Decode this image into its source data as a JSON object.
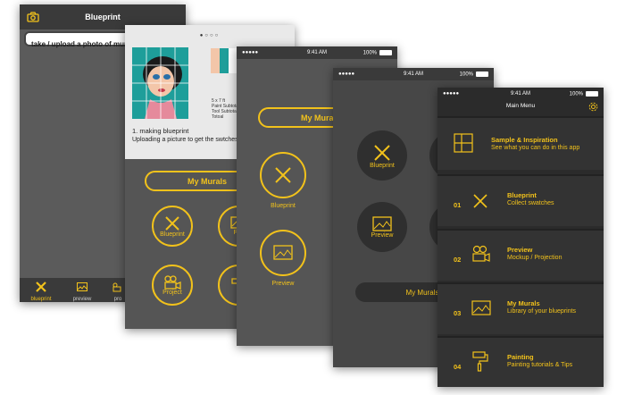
{
  "screen1": {
    "title": "Blueprint",
    "prompt": "take / upload a photo of mural",
    "tabs": [
      {
        "label": "blueprint",
        "icon": "pencil-cross-icon"
      },
      {
        "label": "preview",
        "icon": "picture-icon"
      },
      {
        "label": "pro",
        "icon": "projector-icon"
      }
    ]
  },
  "screen2": {
    "dots": 4,
    "active_dot": 0,
    "step_title": "1. making blueprint",
    "step_desc": "Uploading a picture to get the swtches & price eastimate",
    "details": [
      "5 x 7 ft",
      "Paint Subtotal",
      "Tool Subtotal",
      "Totoal"
    ],
    "my_murals": "My Murals",
    "circles": [
      {
        "label": "Blueprint",
        "icon": "pencil-cross-icon"
      },
      {
        "label": "Pre",
        "icon": "picture-icon"
      },
      {
        "label": "Project",
        "icon": "projector-icon"
      },
      {
        "label": "",
        "icon": "paint-roller-icon"
      }
    ],
    "colors": {
      "peach": "#f3c6a9",
      "teal": "#1e9e9a",
      "pink": "#e58a9c"
    }
  },
  "screen3": {
    "status": {
      "carrier": "●●●●●",
      "time": "9:41 AM",
      "battery": "100%"
    },
    "my_murals": "My Murals",
    "circles": [
      {
        "label": "Blueprint",
        "icon": "pencil-cross-icon"
      },
      {
        "label": "Preview",
        "icon": "picture-icon"
      }
    ]
  },
  "screen4": {
    "status": {
      "carrier": "●●●●●",
      "time": "9:41 AM",
      "battery": "100%"
    },
    "my_murals": "My Murals",
    "circles": [
      {
        "label": "Blueprint",
        "icon": "pencil-cross-icon"
      },
      {
        "label": "Preview",
        "icon": "picture-icon"
      }
    ]
  },
  "screen5": {
    "status": {
      "carrier": "●●●●●",
      "time": "9:41 AM",
      "battery": "100%"
    },
    "title": "Main Menu",
    "items": [
      {
        "num": "",
        "title": "Sample & Inspiration",
        "subtitle": "See what you can do in this app",
        "icon": "grid-icon"
      },
      {
        "num": "01",
        "title": "Blueprint",
        "subtitle": "Collect swatches",
        "icon": "pencil-cross-icon"
      },
      {
        "num": "02",
        "title": "Preview",
        "subtitle": "Mockup / Projection",
        "icon": "projector-icon"
      },
      {
        "num": "03",
        "title": "My Murals",
        "subtitle": "Library of your blueprints",
        "icon": "picture-icon"
      },
      {
        "num": "04",
        "title": "Painting",
        "subtitle": "Painting tutorials & Tips",
        "icon": "paint-roller-icon"
      }
    ]
  },
  "colors": {
    "accent": "#f2c21b",
    "dark": "#3a3a3a",
    "darker": "#2b2b2b"
  }
}
